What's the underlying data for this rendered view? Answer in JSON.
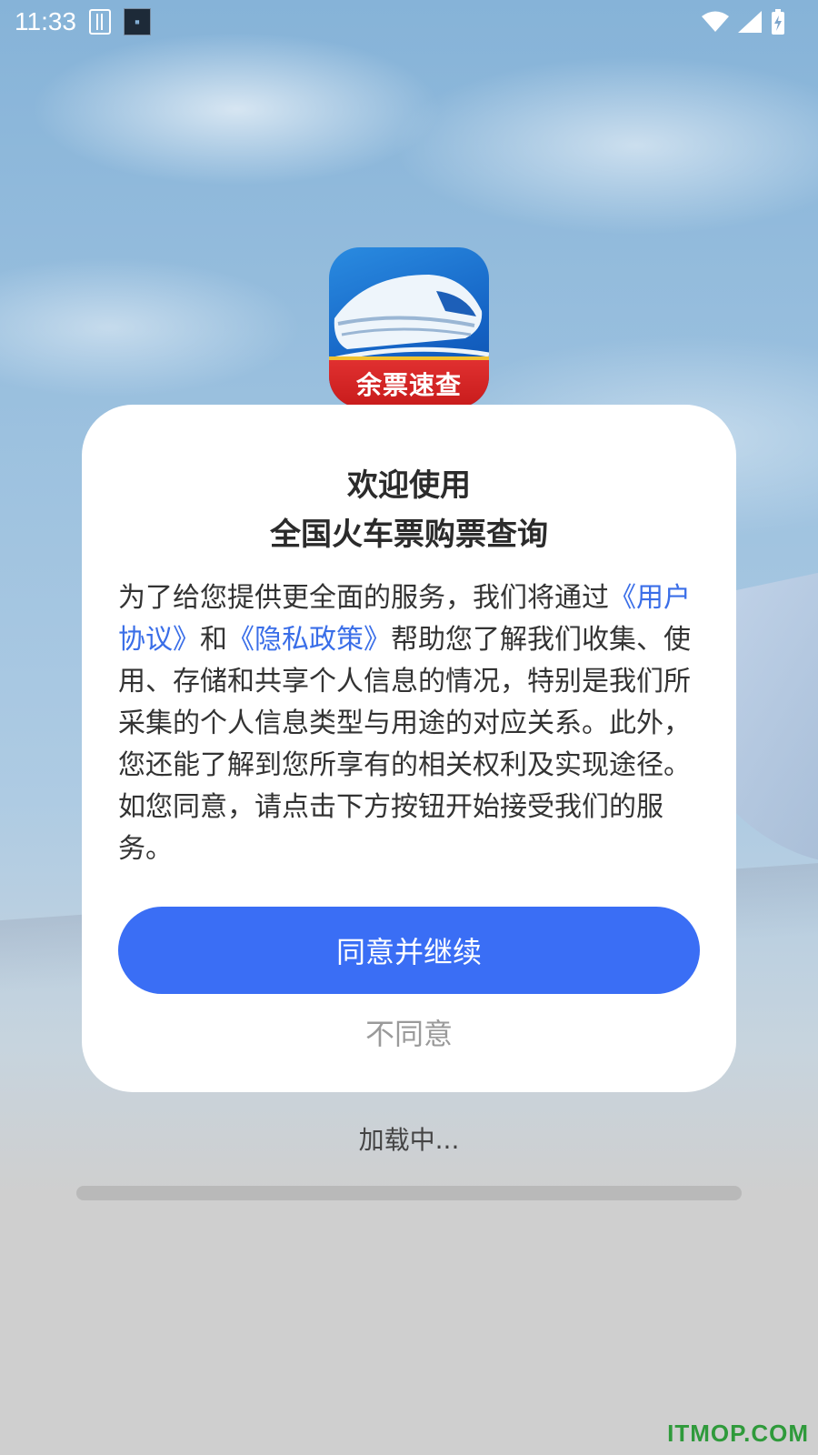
{
  "status_bar": {
    "time": "11:33",
    "icons": [
      "sim-icon",
      "clock-widget-icon",
      "wifi-icon",
      "signal-icon",
      "battery-charging-icon"
    ]
  },
  "app_logo": {
    "banner_text": "余票速查"
  },
  "dialog": {
    "title_line1": "欢迎使用",
    "title_line2": "全国火车票购票查询",
    "body_part1": "为了给您提供更全面的服务，我们将通过",
    "user_agreement_link": "《用户协议》",
    "body_and": "和",
    "privacy_policy_link": "《隐私政策》",
    "body_part2": "帮助您了解我们收集、使用、存储和共享个人信息的情况，特别是我们所采集的个人信息类型与用途的对应关系。此外，您还能了解到您所享有的相关权利及实现途径。如您同意，请点击下方按钮开始接受我们的服务。",
    "agree_label": "同意并继续",
    "disagree_label": "不同意"
  },
  "loading": {
    "text": "加载中...",
    "progress": 0
  },
  "watermark": "ITMOP.COM",
  "colors": {
    "accent": "#3a6ef5",
    "link": "#3a6ee8",
    "logo_banner": "#d42424"
  }
}
